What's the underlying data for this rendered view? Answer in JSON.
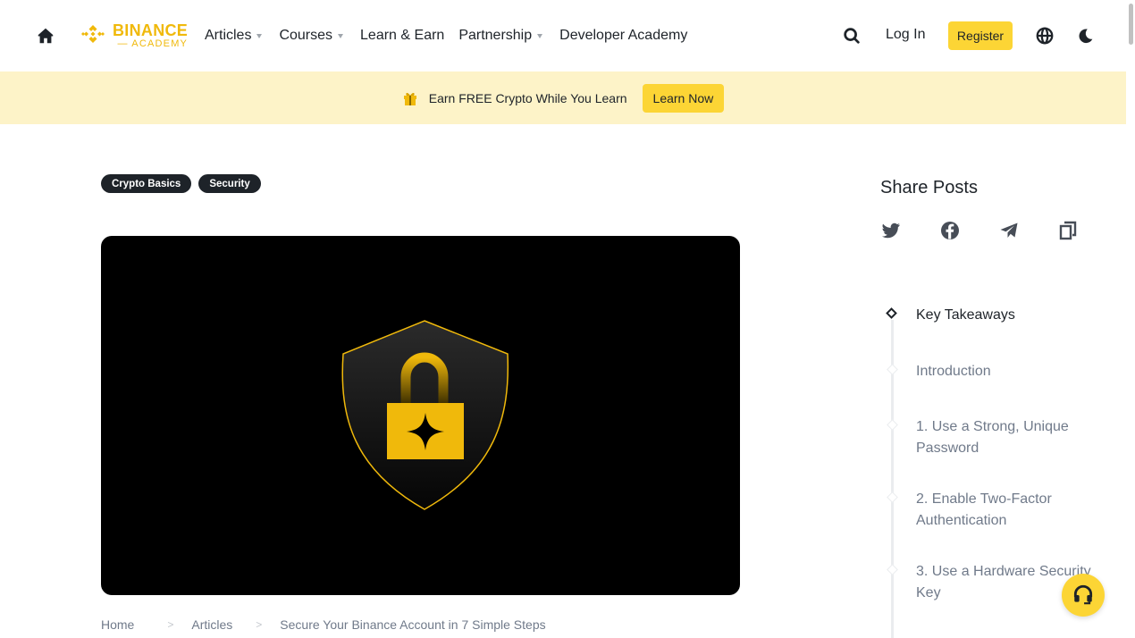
{
  "header": {
    "logo": {
      "line1": "BINANCE",
      "line2": "ACADEMY"
    },
    "nav": [
      {
        "label": "Articles",
        "dropdown": true
      },
      {
        "label": "Courses",
        "dropdown": true
      },
      {
        "label": "Learn & Earn",
        "dropdown": false
      },
      {
        "label": "Partnership",
        "dropdown": true
      },
      {
        "label": "Developer Academy",
        "dropdown": false
      }
    ],
    "login_label": "Log In",
    "register_label": "Register",
    "icons": [
      "home-icon",
      "search-icon",
      "globe-icon",
      "moon-icon"
    ]
  },
  "banner": {
    "icon": "gift-icon",
    "text": "Earn FREE Crypto While You Learn",
    "cta_label": "Learn Now"
  },
  "tags": [
    "Crypto Basics",
    "Security"
  ],
  "hero": {
    "icon": "shield-lock-icon"
  },
  "breadcrumb": [
    "Home",
    "Articles",
    "Secure Your Binance Account in 7 Simple Steps"
  ],
  "share": {
    "title": "Share Posts",
    "icons": [
      "twitter-icon",
      "facebook-icon",
      "telegram-icon",
      "copy-icon"
    ]
  },
  "toc": [
    {
      "label": "Key Takeaways",
      "active": true
    },
    {
      "label": "Introduction",
      "active": false
    },
    {
      "label": "1. Use a Strong, Unique Password",
      "active": false
    },
    {
      "label": "2. Enable Two-Factor Authentication",
      "active": false
    },
    {
      "label": "3. Use a Hardware Security Key",
      "active": false
    }
  ],
  "colors": {
    "brand": "#f0b90b",
    "button": "#fcd535",
    "banner_bg": "#fdf3c8",
    "text": "#1e2329",
    "muted": "#707a8a"
  }
}
